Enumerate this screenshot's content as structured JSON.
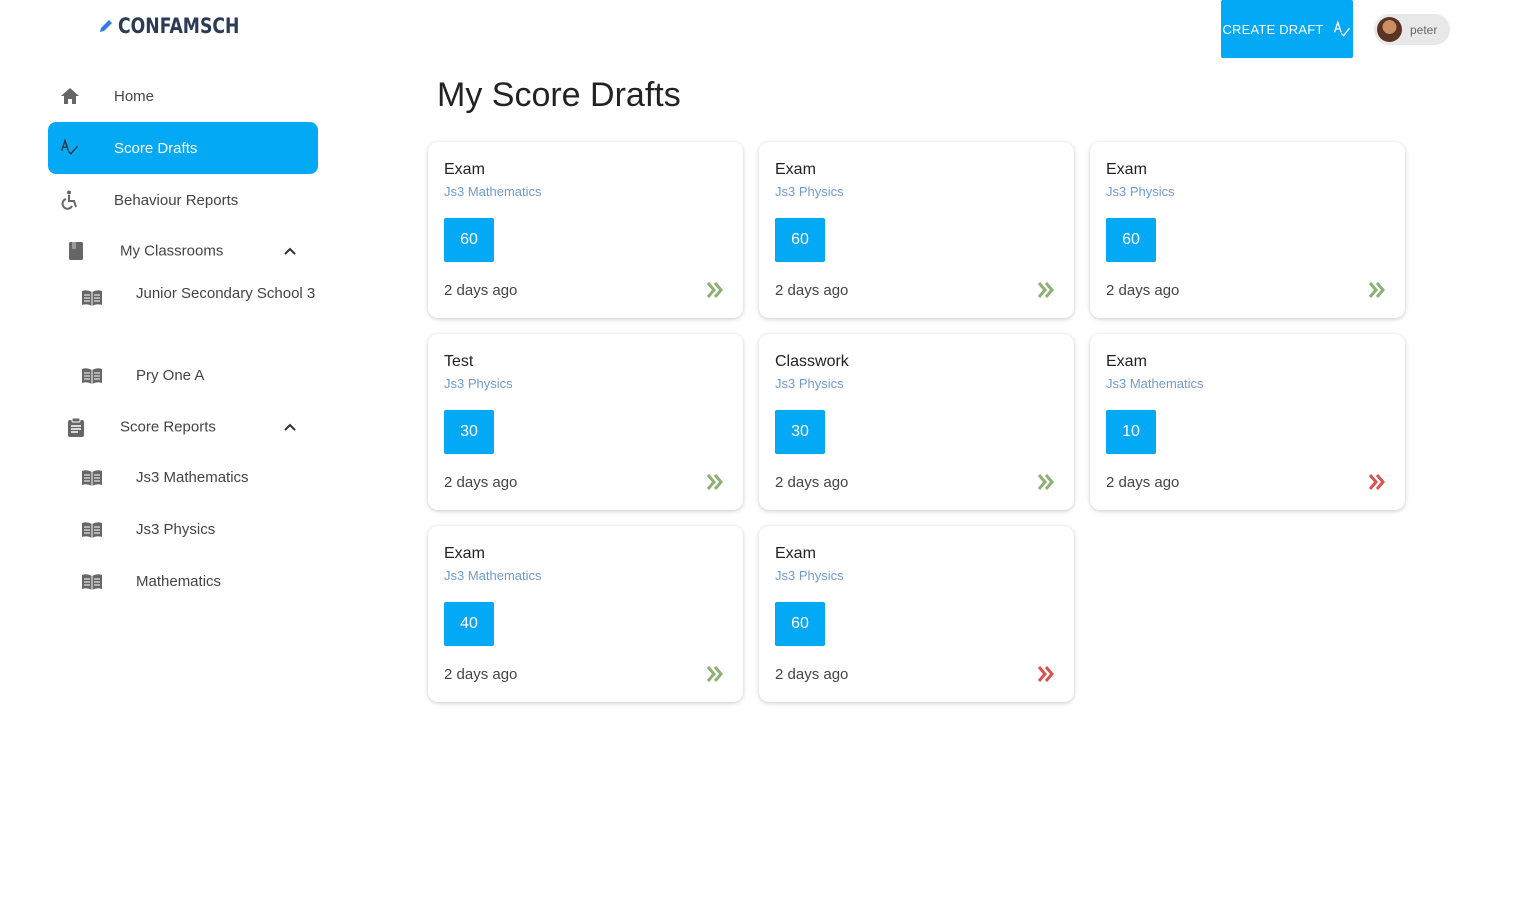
{
  "brand": {
    "name": "CONFAMSCH"
  },
  "header": {
    "create_label": "CREATE DRAFT",
    "user_name": "peter"
  },
  "sidebar": {
    "home": "Home",
    "score_drafts": "Score Drafts",
    "behaviour_reports": "Behaviour Reports",
    "my_classrooms": {
      "label": "My Classrooms",
      "items": [
        "Junior Secondary School 3",
        "Pry One A"
      ]
    },
    "score_reports": {
      "label": "Score Reports",
      "items": [
        "Js3 Mathematics",
        "Js3 Physics",
        "Mathematics"
      ]
    }
  },
  "main": {
    "title": "My Score Drafts",
    "cards": [
      {
        "type": "Exam",
        "subject": "Js3 Mathematics",
        "score": "60",
        "time": "2 days ago",
        "status": "green"
      },
      {
        "type": "Exam",
        "subject": "Js3 Physics",
        "score": "60",
        "time": "2 days ago",
        "status": "green"
      },
      {
        "type": "Exam",
        "subject": "Js3 Physics",
        "score": "60",
        "time": "2 days ago",
        "status": "green"
      },
      {
        "type": "Test",
        "subject": "Js3 Physics",
        "score": "30",
        "time": "2 days ago",
        "status": "green"
      },
      {
        "type": "Classwork",
        "subject": "Js3 Physics",
        "score": "30",
        "time": "2 days ago",
        "status": "green"
      },
      {
        "type": "Exam",
        "subject": "Js3 Mathematics",
        "score": "10",
        "time": "2 days ago",
        "status": "red"
      },
      {
        "type": "Exam",
        "subject": "Js3 Mathematics",
        "score": "40",
        "time": "2 days ago",
        "status": "green"
      },
      {
        "type": "Exam",
        "subject": "Js3 Physics",
        "score": "60",
        "time": "2 days ago",
        "status": "red"
      }
    ]
  },
  "colors": {
    "accent": "#03a9f4",
    "status_green": "#8bb174",
    "status_red": "#d9534f",
    "subject_text": "#6f9bd1"
  },
  "icons": {
    "logo": "pencil-icon",
    "create": "spellcheck-icon",
    "home": "home-icon",
    "score_drafts": "spellcheck-icon",
    "behaviour": "accessible-icon",
    "classrooms": "book-icon",
    "class_item": "open-book-icon",
    "score_reports": "clipboard-icon",
    "expand": "chevron-up-icon",
    "card_go": "double-chevron-right-icon"
  }
}
